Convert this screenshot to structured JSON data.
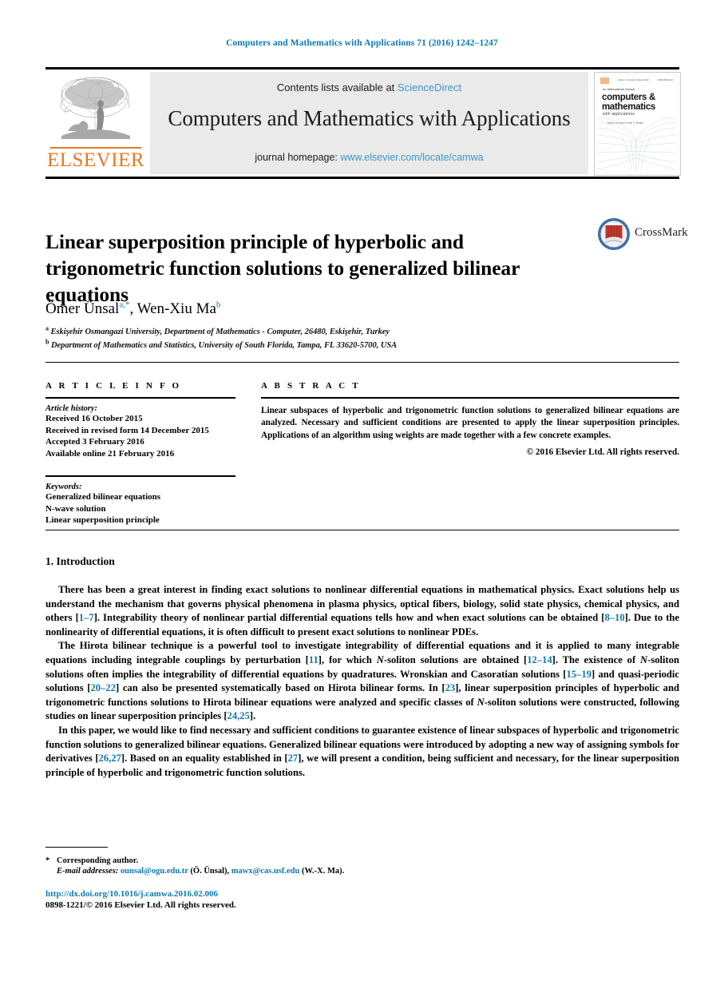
{
  "running_head": "Computers and Mathematics with Applications 71 (2016) 1242–1247",
  "masthead": {
    "contents_prefix": "Contents lists available at ",
    "sciencedirect": "ScienceDirect",
    "journal_title": "Computers and Mathematics with Applications",
    "homepage_prefix": "journal homepage: ",
    "homepage_url": "www.elsevier.com/locate/camwa",
    "publisher_wordmark": "ELSEVIER",
    "publisher_logo_name": "elsevier-tree-logo"
  },
  "cover": {
    "top_left_text": "ELSEVIER",
    "top_center_text": "Volume 71 Number 6 March 2016",
    "top_right_text": "ISSN 0898-1221",
    "supertitle": "An International Journal",
    "line1": "computers &",
    "line2": "mathematics",
    "line3": "with applications",
    "editors": "Editor-in-Chief:  Ervin Y. Rodin"
  },
  "article": {
    "title": "Linear superposition principle of hyperbolic and trigonometric function solutions to generalized bilinear equations",
    "crossmark_label": "CrossMark",
    "authors": [
      {
        "name": "Ömer Ünsal",
        "marks": "a,*"
      },
      {
        "name": "Wen-Xiu Ma",
        "marks": "b"
      }
    ],
    "authors_line_sep": ", ",
    "affiliations": [
      {
        "mark": "a",
        "text": "Eskişehir Osmangazi University, Department of Mathematics - Computer, 26480, Eskişehir, Turkey"
      },
      {
        "mark": "b",
        "text": "Department of Mathematics and Statistics, University of South Florida, Tampa, FL 33620-5700, USA"
      }
    ]
  },
  "info": {
    "heading": "A R T I C L E   I N F O",
    "history_label": "Article history:",
    "history": [
      "Received 16 October 2015",
      "Received in revised form 14 December 2015",
      "Accepted 3 February 2016",
      "Available online 21 February 2016"
    ],
    "keywords_label": "Keywords:",
    "keywords": [
      "Generalized bilinear equations",
      "N-wave solution",
      "Linear superposition principle"
    ]
  },
  "abstract": {
    "heading": "A B S T R A C T",
    "text": "Linear subspaces of hyperbolic and trigonometric function solutions to generalized bilinear equations are analyzed. Necessary and sufficient conditions are presented to apply the linear superposition principles. Applications of an algorithm using weights are made together with a few concrete examples.",
    "copyright": "© 2016 Elsevier Ltd. All rights reserved."
  },
  "section": {
    "heading": "1. Introduction",
    "paragraphs": [
      "There has been a great interest in finding exact solutions to nonlinear differential equations in mathematical physics. Exact solutions help us understand the mechanism that governs physical phenomena in plasma physics, optical fibers, biology, solid state physics, chemical physics, and others [1–7]. Integrability theory of nonlinear partial differential equations tells how and when exact solutions can be obtained [8–10]. Due to the nonlinearity of differential equations, it is often difficult to present exact solutions to nonlinear PDEs.",
      "The Hirota bilinear technique is a powerful tool to investigate integrability of differential equations and it is applied to many integrable equations including integrable couplings by perturbation [11], for which N-soliton solutions are obtained [12–14]. The existence of N-soliton solutions often implies the integrability of differential equations by quadratures. Wronskian and Casoratian solutions [15–19] and quasi-periodic solutions [20–22] can also be presented systematically based on Hirota bilinear forms. In [23], linear superposition principles of hyperbolic and trigonometric functions solutions to Hirota bilinear equations were analyzed and specific classes of N-soliton solutions were constructed, following studies on linear superposition principles [24,25].",
      "In this paper, we would like to find necessary and sufficient conditions to guarantee existence of linear subspaces of hyperbolic and trigonometric function solutions to generalized bilinear equations. Generalized bilinear equations were introduced by adopting a new way of assigning symbols for derivatives [26,27]. Based on an equality established in [27], we will present a condition, being sufficient and necessary, for the linear superposition principle of hyperbolic and trigonometric function solutions."
    ]
  },
  "footer": {
    "corresponding_mark": "*",
    "corresponding_text": "Corresponding author.",
    "email_label": "E-mail addresses:",
    "emails": [
      {
        "address": "ounsal@ogu.edu.tr",
        "owner": "(Ö. Ünsal)"
      },
      {
        "address": "mawx@cas.usf.edu",
        "owner": "(W.-X. Ma)"
      }
    ],
    "doi": "http://dx.doi.org/10.1016/j.camwa.2016.02.006",
    "issn": "0898-1221/© 2016 Elsevier Ltd. All rights reserved."
  },
  "colors": {
    "link_blue": "#0a7ab0",
    "sciencedirect_blue": "#3c96c8",
    "elsevier_orange": "#e87722",
    "panel_grey": "#eaeaea"
  }
}
